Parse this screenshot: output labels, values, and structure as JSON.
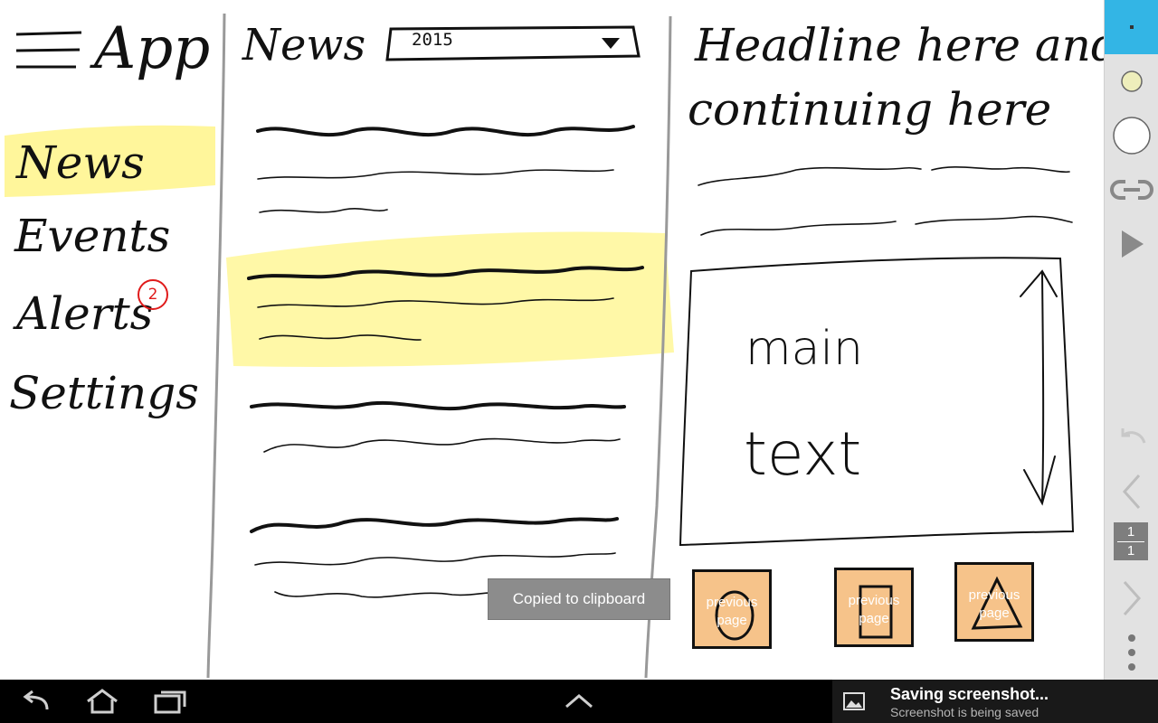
{
  "sketch": {
    "app_title": "App",
    "nav": [
      "News",
      "Events",
      "Alerts",
      "Settings"
    ],
    "alerts_badge": "2",
    "news_title": "News",
    "year_select": "2015",
    "headline_line1": "Headline here and",
    "headline_line2": "continuing here",
    "main_text_line1": "main",
    "main_text_line2": "text",
    "page_buttons": [
      {
        "label": "previous page",
        "shape": "circle"
      },
      {
        "label": "previous page",
        "shape": "rectangle"
      },
      {
        "label": "previous page",
        "shape": "triangle"
      }
    ],
    "highlight_color": "#fff58a"
  },
  "toast": {
    "text": "Copied to clipboard"
  },
  "toolstrip": {
    "accent": "#33b5e5",
    "page_current": "1",
    "page_total": "1",
    "tools": [
      "pen-tool-icon",
      "color-icon",
      "brush-size-icon",
      "link-icon",
      "play-icon",
      "undo-icon",
      "previous-icon",
      "next-icon",
      "more-icon"
    ]
  },
  "navbar": {
    "notification_title": "Saving screenshot...",
    "notification_subtitle": "Screenshot is being saved"
  }
}
